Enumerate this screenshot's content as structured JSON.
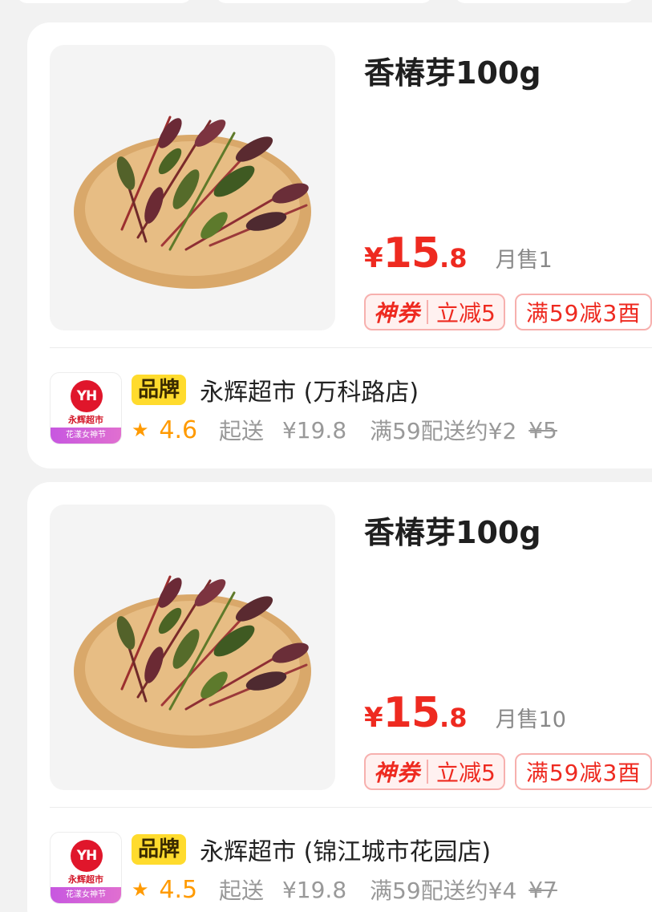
{
  "products": [
    {
      "title": "香椿芽100g",
      "price": {
        "currency": "¥",
        "integer": "15",
        "decimal": ".8"
      },
      "monthly_sales": "月售1",
      "coupon": {
        "label": "神券",
        "discount": "立减5"
      },
      "promo": "满59减3酉",
      "store": {
        "logo": {
          "mark": "YH",
          "name": "永辉超市",
          "band": "花漾女神节"
        },
        "badge": "品牌",
        "name": "永辉超市 (万科路店)",
        "star": "★",
        "rating": "4.6",
        "min_order_label": "起送",
        "min_order_value": "¥19.8",
        "delivery": "满59配送约¥2",
        "delivery_original": "¥5"
      }
    },
    {
      "title": "香椿芽100g",
      "price": {
        "currency": "¥",
        "integer": "15",
        "decimal": ".8"
      },
      "monthly_sales": "月售10",
      "coupon": {
        "label": "神券",
        "discount": "立减5"
      },
      "promo": "满59减3酉",
      "store": {
        "logo": {
          "mark": "YH",
          "name": "永辉超市",
          "band": "花漾女神节"
        },
        "badge": "品牌",
        "name": "永辉超市 (锦江城市花园店)",
        "star": "★",
        "rating": "4.5",
        "min_order_label": "起送",
        "min_order_value": "¥19.8",
        "delivery": "满59配送约¥4",
        "delivery_original": "¥7"
      }
    }
  ],
  "colors": {
    "price_red": "#ee2a20",
    "brand_yellow": "#ffdb2d",
    "rating_orange": "#ff9a00",
    "background": "#f2f2f2"
  }
}
